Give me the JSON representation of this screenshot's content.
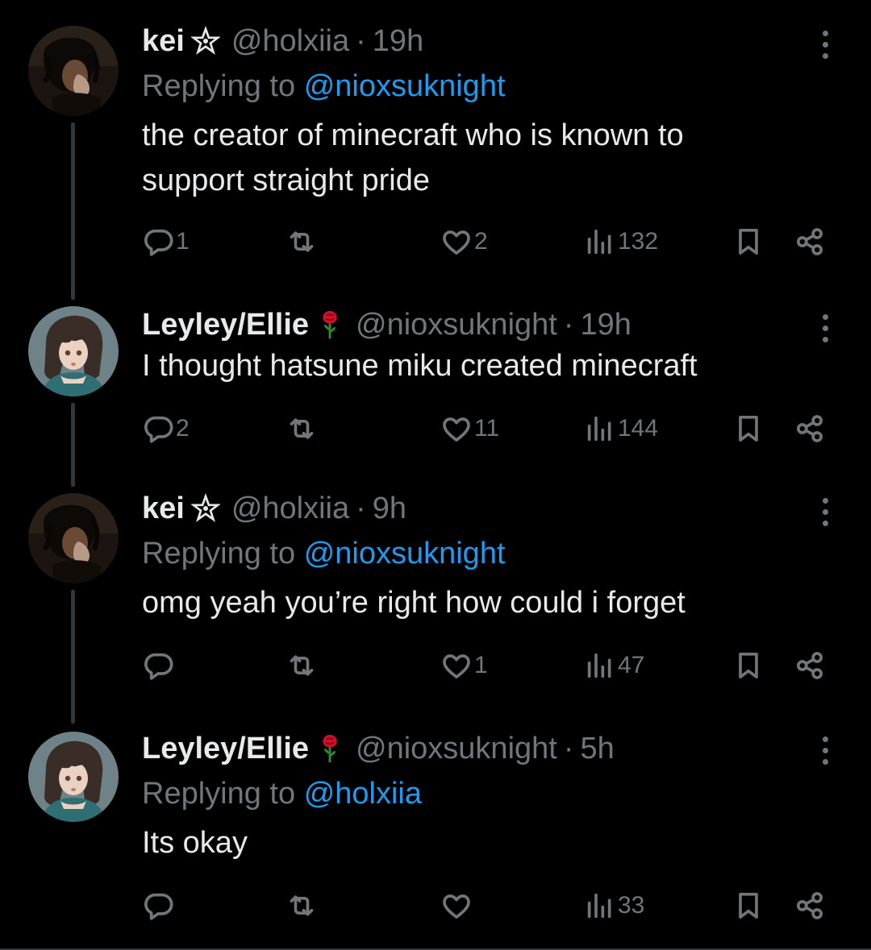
{
  "tweets": [
    {
      "name": "kei",
      "badge_icon": "pentagram-icon",
      "handle": "@holxiia",
      "dot": "·",
      "time": "19h",
      "replying_prefix": "Replying to",
      "replying_to": "@nioxsuknight",
      "text_line1": "the creator of minecraft who is known to",
      "text_line2": "support straight pride",
      "replies": "1",
      "retweets": "",
      "likes": "2",
      "views": "132"
    },
    {
      "name": "Leyley/Ellie",
      "badge_icon": "rose-icon",
      "handle": "@nioxsuknight",
      "dot": "·",
      "time": "19h",
      "text_line1": "I thought hatsune miku created minecraft",
      "replies": "2",
      "retweets": "",
      "likes": "11",
      "views": "144"
    },
    {
      "name": "kei",
      "badge_icon": "pentagram-icon",
      "handle": "@holxiia",
      "dot": "·",
      "time": "9h",
      "replying_prefix": "Replying to",
      "replying_to": "@nioxsuknight",
      "text_line1": "omg yeah you’re right how could i forget",
      "replies": "",
      "retweets": "",
      "likes": "1",
      "views": "47"
    },
    {
      "name": "Leyley/Ellie",
      "badge_icon": "rose-icon",
      "handle": "@nioxsuknight",
      "dot": "·",
      "time": "5h",
      "replying_prefix": "Replying to",
      "replying_to": "@holxiia",
      "text_line1": "Its okay",
      "replies": "",
      "retweets": "",
      "likes": "",
      "views": "33"
    }
  ],
  "colors": {
    "background": "#000000",
    "text": "#e7e9ea",
    "muted": "#71767b",
    "link": "#1d9bf0",
    "connector": "#333639"
  }
}
